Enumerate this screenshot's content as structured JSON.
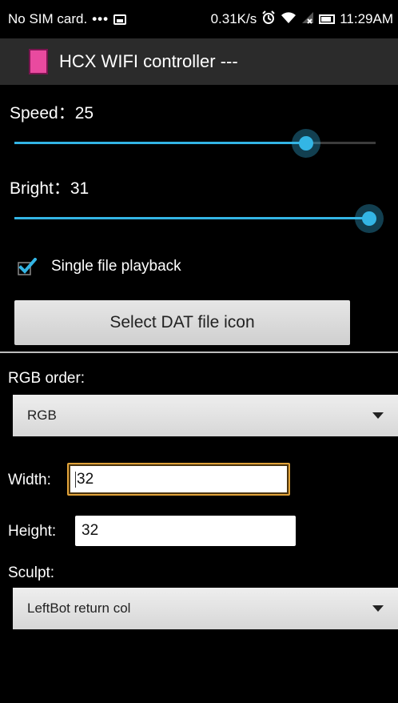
{
  "status_bar": {
    "carrier": "No SIM card.",
    "dots": "•••",
    "speed": "0.31K/s",
    "time": "11:29AM",
    "icons": [
      "image-notification-icon",
      "alarm-icon",
      "wifi-icon",
      "signal-icon",
      "battery-icon"
    ]
  },
  "title_bar": {
    "title": "HCX WIFI controller ---",
    "icon_color": "#e94a9f"
  },
  "speed": {
    "label": "Speed：25",
    "value": 25
  },
  "bright": {
    "label": "Bright：31",
    "value": 31
  },
  "checkbox": {
    "label": "Single file playback",
    "checked": true
  },
  "select_button": {
    "label": "Select DAT file icon"
  },
  "rgb": {
    "label": "RGB order:",
    "selected": "RGB"
  },
  "width": {
    "label": "Width:",
    "value": "32"
  },
  "height": {
    "label": "Height:",
    "value": "32"
  },
  "sculpt": {
    "label": "Sculpt:",
    "selected": "LeftBot return col"
  },
  "colors": {
    "accent": "#33b5e5",
    "focus": "#e1a33a"
  }
}
